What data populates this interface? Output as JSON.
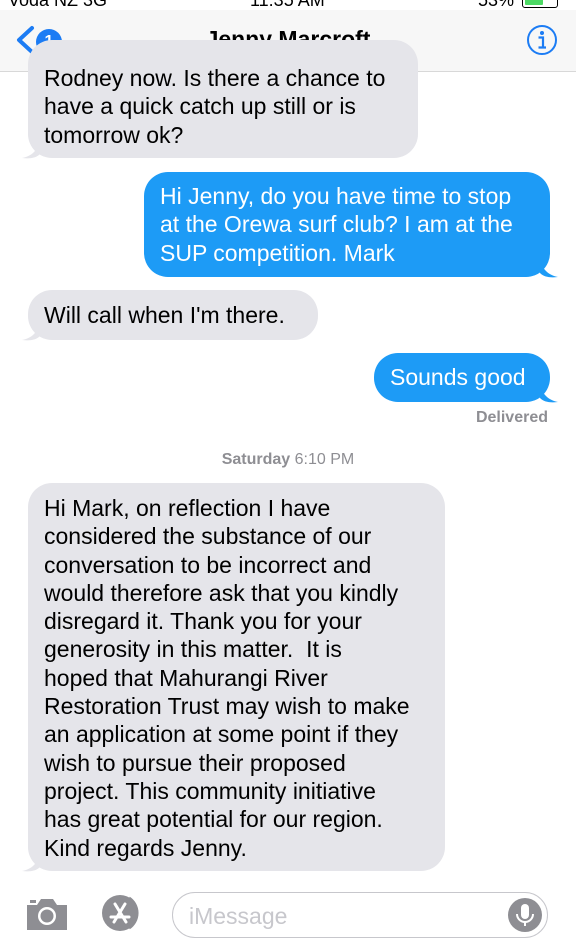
{
  "status_bar": {
    "carrier": "Voda NZ 3G",
    "time": "11:35 AM",
    "battery": "53%",
    "battery_fill": 0.53
  },
  "header": {
    "back_badge": "1",
    "title": "Jenny Marcroft"
  },
  "messages": [
    {
      "direction": "incoming",
      "lines": [
        "Rodney now. Is there a chance to",
        "have a quick catch up still or is",
        "tomorrow ok?"
      ]
    },
    {
      "direction": "outgoing",
      "lines": [
        "Hi Jenny, do you have time to stop",
        "at the Orewa surf club? I am at the",
        "SUP competition. Mark"
      ]
    },
    {
      "direction": "incoming",
      "lines": [
        "Will call when I'm there."
      ]
    },
    {
      "direction": "outgoing",
      "lines": [
        "Sounds good"
      ]
    }
  ],
  "delivered_label": "Delivered",
  "timestamp": {
    "day": "Saturday",
    "time": "6:10 PM"
  },
  "last_message": {
    "direction": "incoming",
    "lines": [
      "Hi Mark, on reflection I have",
      "considered the substance of our",
      "conversation to be incorrect and",
      "would therefore ask that you kindly",
      "disregard it. Thank you for your",
      "generosity in this matter.  It is",
      "hoped that Mahurangi River",
      "Restoration Trust may wish to make",
      "an application at some point if they",
      "wish to pursue their proposed",
      "project. This community initiative",
      "has great potential for our region.",
      "Kind regards Jenny."
    ]
  },
  "input": {
    "placeholder": "iMessage"
  },
  "icons": {
    "back": "chevron-left-icon",
    "info": "info-icon",
    "camera": "camera-icon",
    "apps": "app-store-icon",
    "mic": "microphone-icon"
  },
  "colors": {
    "accent": "#1c7cf4",
    "outgoing_bubble": "#1d9bf6",
    "incoming_bubble": "#e5e5ea",
    "secondary_text": "#8e8e93"
  }
}
